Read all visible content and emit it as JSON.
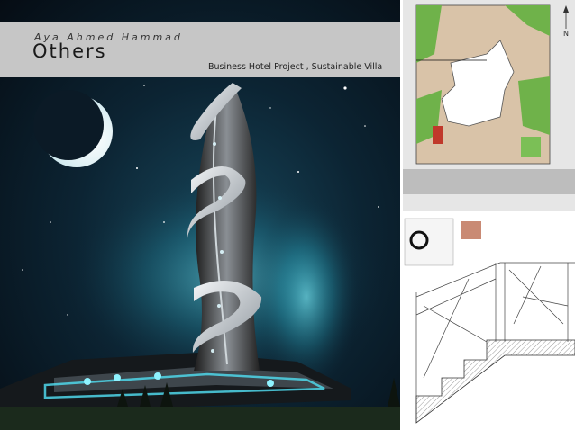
{
  "sheet": {
    "author": "Aya Ahmed Hammad",
    "heading": "Others",
    "subtitle": "Business Hotel Project , Sustainable Villa"
  },
  "site_plan": {
    "north_label": "N"
  },
  "colors": {
    "night_sky": "#0b1a26",
    "glow": "#3fd4e8",
    "title_band": "#c6c6c6",
    "landscape_green": "#6fb24a",
    "paving": "#d9c3a8"
  }
}
